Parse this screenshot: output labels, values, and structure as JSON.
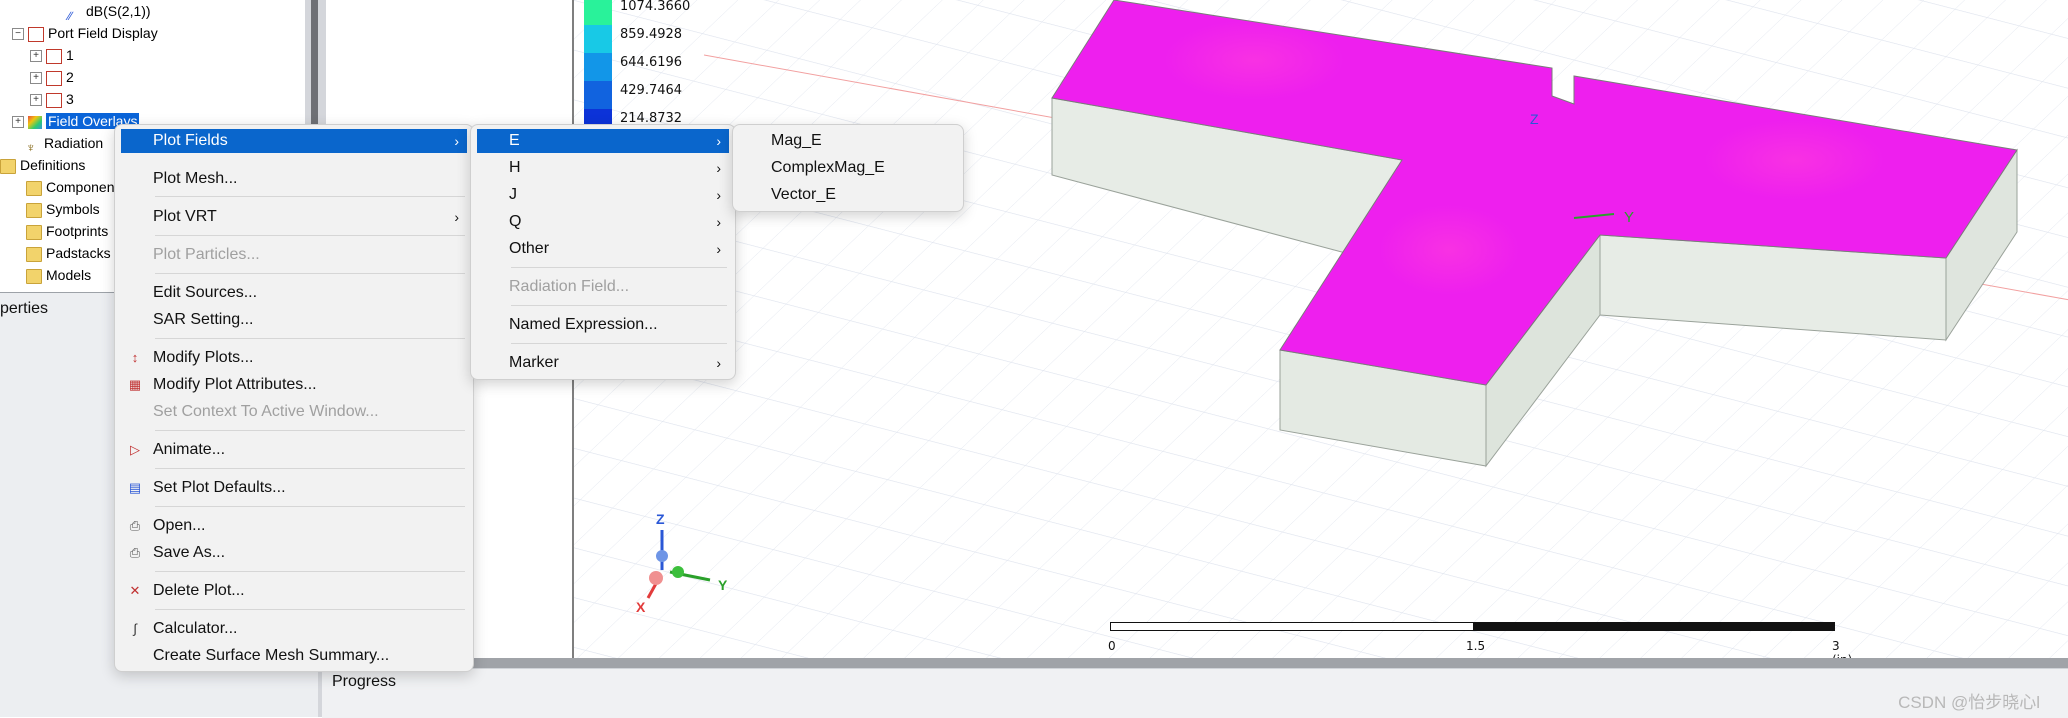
{
  "tree": {
    "items": [
      {
        "label": "dB(S(2,1))",
        "icon": "trace-icon"
      },
      {
        "label": "Port Field Display",
        "icon": "plot-folder-icon"
      },
      {
        "label": "1",
        "icon": "plot-icon"
      },
      {
        "label": "2",
        "icon": "plot-icon"
      },
      {
        "label": "3",
        "icon": "plot-icon"
      },
      {
        "label": "Field Overlays",
        "icon": "field-overlays-icon"
      },
      {
        "label": "Radiation",
        "icon": "radiation-icon"
      },
      {
        "label": "Definitions",
        "icon": "folder-icon"
      },
      {
        "label": "Componen",
        "icon": "folder-icon"
      },
      {
        "label": "Symbols",
        "icon": "folder-icon"
      },
      {
        "label": "Footprints",
        "icon": "folder-icon"
      },
      {
        "label": "Padstacks",
        "icon": "folder-icon"
      },
      {
        "label": "Models",
        "icon": "folder-icon"
      }
    ]
  },
  "properties": {
    "title": "perties"
  },
  "legend": {
    "values": [
      "1074.3660",
      "859.4928",
      "644.6196",
      "429.7464",
      "214.8732"
    ],
    "colors": [
      "#29f29a",
      "#18c9e6",
      "#1296e8",
      "#1163df",
      "#0c33d8"
    ]
  },
  "menu_main": {
    "items": [
      {
        "label": "Plot Fields",
        "has_sub": true,
        "highlighted": true
      },
      {
        "label": "Plot Mesh..."
      },
      {
        "label": "Plot VRT",
        "has_sub": true
      },
      {
        "label": "Plot Particles...",
        "disabled": true
      },
      {
        "label": "Edit Sources..."
      },
      {
        "label": "SAR Setting..."
      },
      {
        "label": "Modify Plots...",
        "icon": "modify-plots-icon"
      },
      {
        "label": "Modify Plot Attributes...",
        "icon": "plot-attributes-icon"
      },
      {
        "label": "Set Context To Active Window...",
        "disabled": true
      },
      {
        "label": "Animate...",
        "icon": "animate-icon"
      },
      {
        "label": "Set Plot Defaults...",
        "icon": "plot-defaults-icon"
      },
      {
        "label": "Open...",
        "icon": "open-icon"
      },
      {
        "label": "Save As...",
        "icon": "save-as-icon"
      },
      {
        "label": "Delete Plot...",
        "icon": "delete-plot-icon"
      },
      {
        "label": "Calculator...",
        "icon": "calculator-icon"
      },
      {
        "label": "Create Surface Mesh Summary..."
      }
    ]
  },
  "menu_fields": {
    "items": [
      {
        "label": "E",
        "has_sub": true,
        "highlighted": true
      },
      {
        "label": "H",
        "has_sub": true
      },
      {
        "label": "J",
        "has_sub": true
      },
      {
        "label": "Q",
        "has_sub": true
      },
      {
        "label": "Other",
        "has_sub": true
      },
      {
        "label": "Radiation Field...",
        "disabled": true
      },
      {
        "label": "Named Expression..."
      },
      {
        "label": "Marker",
        "has_sub": true
      }
    ]
  },
  "menu_e": {
    "items": [
      {
        "label": "Mag_E"
      },
      {
        "label": "ComplexMag_E"
      },
      {
        "label": "Vector_E"
      }
    ]
  },
  "axes": {
    "x": "X",
    "y": "Y",
    "z": "Z"
  },
  "scale": {
    "ticks": [
      "0",
      "1.5",
      "3 (in)"
    ]
  },
  "progress": {
    "label": "Progress"
  },
  "watermark": "CSDN @怡步晓心l",
  "colors": {
    "field": "#ee1fee",
    "highlight": "#0a66cc",
    "grid": "#dde3ee"
  }
}
